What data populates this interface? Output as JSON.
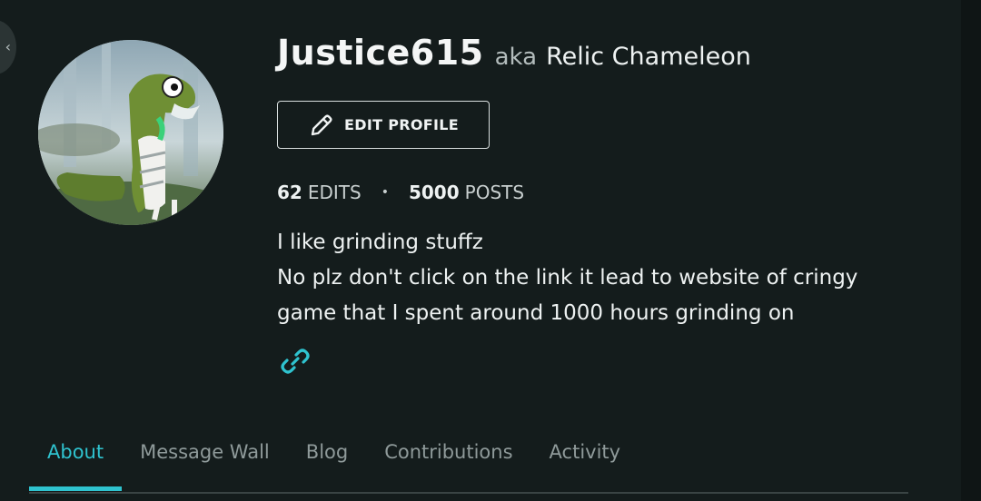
{
  "profile": {
    "username": "Justice615",
    "aka_label": "aka",
    "alias": "Relic Chameleon",
    "edit_button_label": "EDIT PROFILE",
    "stats": {
      "edits_count": "62",
      "edits_label": "EDITS",
      "separator": "•",
      "posts_count": "5000",
      "posts_label": "POSTS"
    },
    "bio_lines": [
      "I like grinding stuffz",
      "No plz don't click on the link it lead to website of cringy",
      "game that I spent around 1000 hours grinding on"
    ]
  },
  "tabs": [
    {
      "label": "About",
      "active": true
    },
    {
      "label": "Message Wall",
      "active": false
    },
    {
      "label": "Blog",
      "active": false
    },
    {
      "label": "Contributions",
      "active": false
    },
    {
      "label": "Activity",
      "active": false
    }
  ],
  "icons": {
    "edit": "pencil-icon",
    "link": "link-icon",
    "back": "chevron-left-icon"
  },
  "colors": {
    "background": "#141c1c",
    "accent": "#2fc3cf",
    "text": "#eef2f2",
    "muted": "#8f9a9a"
  }
}
